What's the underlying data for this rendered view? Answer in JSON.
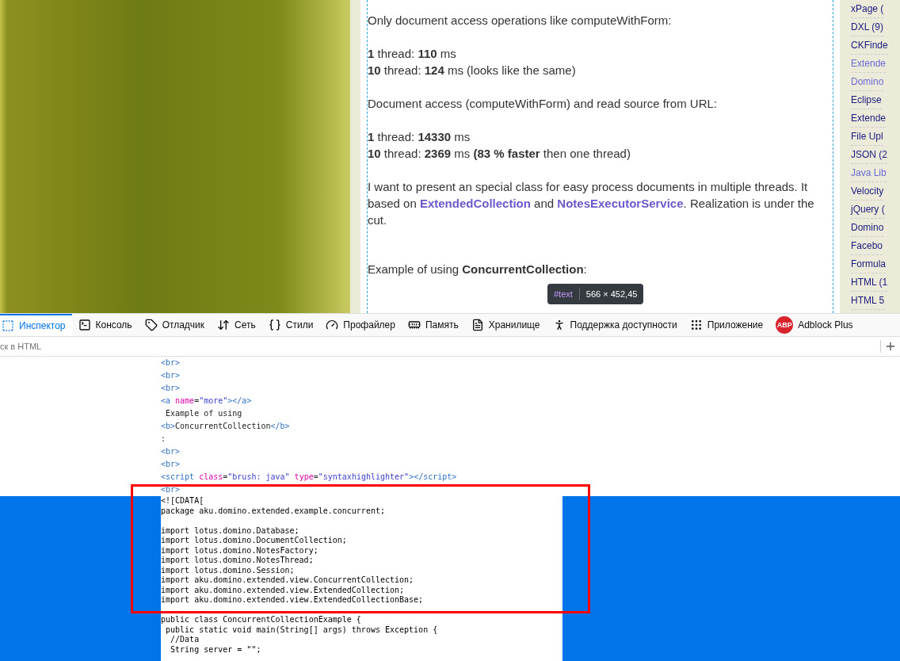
{
  "article": {
    "paragraphs": [
      [
        {
          "kind": "text",
          "text": "Only document access operations like computeWithForm:"
        }
      ],
      [
        {
          "kind": "text",
          "text": "**1** thread: **110** ms"
        }
      ],
      [
        {
          "kind": "text",
          "text": "**10** thread: **124** ms (looks like the same)"
        }
      ],
      [
        {
          "kind": "text",
          "text": "Document access (computeWithForm) and read source from URL:"
        }
      ],
      [
        {
          "kind": "text",
          "text": "**1** thread: **14330** ms"
        }
      ],
      [
        {
          "kind": "text",
          "text": "**10** thread: **2369** ms **(83 % faster** then one thread)"
        }
      ],
      [
        {
          "kind": "text",
          "text": "I want to present an special class for easy process documents in multiple threads. It based on "
        },
        {
          "kind": "link",
          "text": "ExtendedCollection"
        },
        {
          "kind": "text",
          "text": " and "
        },
        {
          "kind": "link",
          "text": "NotesExecutorService"
        },
        {
          "kind": "text",
          "text": ". Realization is under the cut."
        }
      ],
      [
        {
          "kind": "text",
          "text": " Example of using **ConcurrentCollection**:"
        }
      ]
    ]
  },
  "tooltip": {
    "node": "#text",
    "size": "566 × 452,45"
  },
  "sidebar": {
    "items": [
      {
        "label": "xPage (",
        "visited": false
      },
      {
        "label": "DXL (9)",
        "visited": false
      },
      {
        "label": "CKFinde",
        "visited": false
      },
      {
        "label": "Extende",
        "visited": true
      },
      {
        "label": "Domino",
        "visited": true
      },
      {
        "label": "Eclipse",
        "visited": false
      },
      {
        "label": "Extende",
        "visited": false
      },
      {
        "label": "File Upl",
        "visited": false
      },
      {
        "label": "JSON (2",
        "visited": false
      },
      {
        "label": "Java Lib",
        "visited": true
      },
      {
        "label": "Velocity",
        "visited": false
      },
      {
        "label": "jQuery (",
        "visited": false
      },
      {
        "label": "Domino",
        "visited": false
      },
      {
        "label": "Facebo",
        "visited": false
      },
      {
        "label": "Formula",
        "visited": false
      },
      {
        "label": "HTML (1",
        "visited": false
      },
      {
        "label": "HTML 5",
        "visited": false
      }
    ]
  },
  "devtools": {
    "tabs": [
      {
        "kind": "inspector",
        "label": "Инспектор",
        "selected": true
      },
      {
        "kind": "console",
        "label": "Консоль",
        "selected": false
      },
      {
        "kind": "debugger",
        "label": "Отладчик",
        "selected": false
      },
      {
        "kind": "network",
        "label": "Сеть",
        "selected": false
      },
      {
        "kind": "styles",
        "label": "Стили",
        "selected": false
      },
      {
        "kind": "profiler",
        "label": "Профайлер",
        "selected": false
      },
      {
        "kind": "memory",
        "label": "Память",
        "selected": false
      },
      {
        "kind": "storage",
        "label": "Хранилище",
        "selected": false
      },
      {
        "kind": "accessibility",
        "label": "Поддержка доступности",
        "selected": false
      },
      {
        "kind": "application",
        "label": "Приложение",
        "selected": false
      },
      {
        "kind": "adblock",
        "label": "Adblock Plus",
        "badge": "ABP",
        "selected": false
      }
    ],
    "search": {
      "placeholder": "ск в HTML"
    },
    "tree": [
      [
        {
          "kind": "tag",
          "text": "<br>"
        }
      ],
      [
        {
          "kind": "tag",
          "text": "<br>"
        }
      ],
      [
        {
          "kind": "tag",
          "text": "<br>"
        }
      ],
      [
        {
          "kind": "tag",
          "text": "<a "
        },
        {
          "kind": "attr",
          "text": "name"
        },
        {
          "kind": "plain",
          "text": "="
        },
        {
          "kind": "value",
          "text": "\"more\""
        },
        {
          "kind": "tag",
          "text": "></a>"
        }
      ],
      [
        {
          "kind": "plain",
          "text": " Example of using"
        }
      ],
      [
        {
          "kind": "tag",
          "text": "<b>"
        },
        {
          "kind": "plain",
          "text": "ConcurrentCollection"
        },
        {
          "kind": "tag",
          "text": "</b>"
        }
      ],
      [
        {
          "kind": "plain",
          "text": ":"
        }
      ],
      [
        {
          "kind": "tag",
          "text": "<br>"
        }
      ],
      [
        {
          "kind": "tag",
          "text": "<br>"
        }
      ],
      [
        {
          "kind": "tag",
          "text": "<script "
        },
        {
          "kind": "attr",
          "text": "class"
        },
        {
          "kind": "plain",
          "text": "="
        },
        {
          "kind": "value",
          "text": "\"brush: java\" "
        },
        {
          "kind": "attr",
          "text": "type"
        },
        {
          "kind": "plain",
          "text": "="
        },
        {
          "kind": "value",
          "text": "\"syntaxhighlighter\""
        },
        {
          "kind": "tag",
          "text": "></script>"
        }
      ],
      [
        {
          "kind": "tag",
          "text": "<br>"
        }
      ]
    ],
    "selected_text": [
      "<![CDATA[",
      "package aku.domino.extended.example.concurrent;",
      "\nimport lotus.domino.Database;",
      "import lotus.domino.DocumentCollection;",
      "import lotus.domino.NotesFactory;",
      "import lotus.domino.NotesThread;",
      "import lotus.domino.Session;",
      "import aku.domino.extended.view.ConcurrentCollection;",
      "import aku.domino.extended.view.ExtendedCollection;",
      "import aku.domino.extended.view.ExtendedCollectionBase;",
      "\npublic class ConcurrentCollectionExample {",
      " public static void main(String[] args) throws Exception {",
      "  //Data",
      "  String server = \"\";"
    ]
  }
}
